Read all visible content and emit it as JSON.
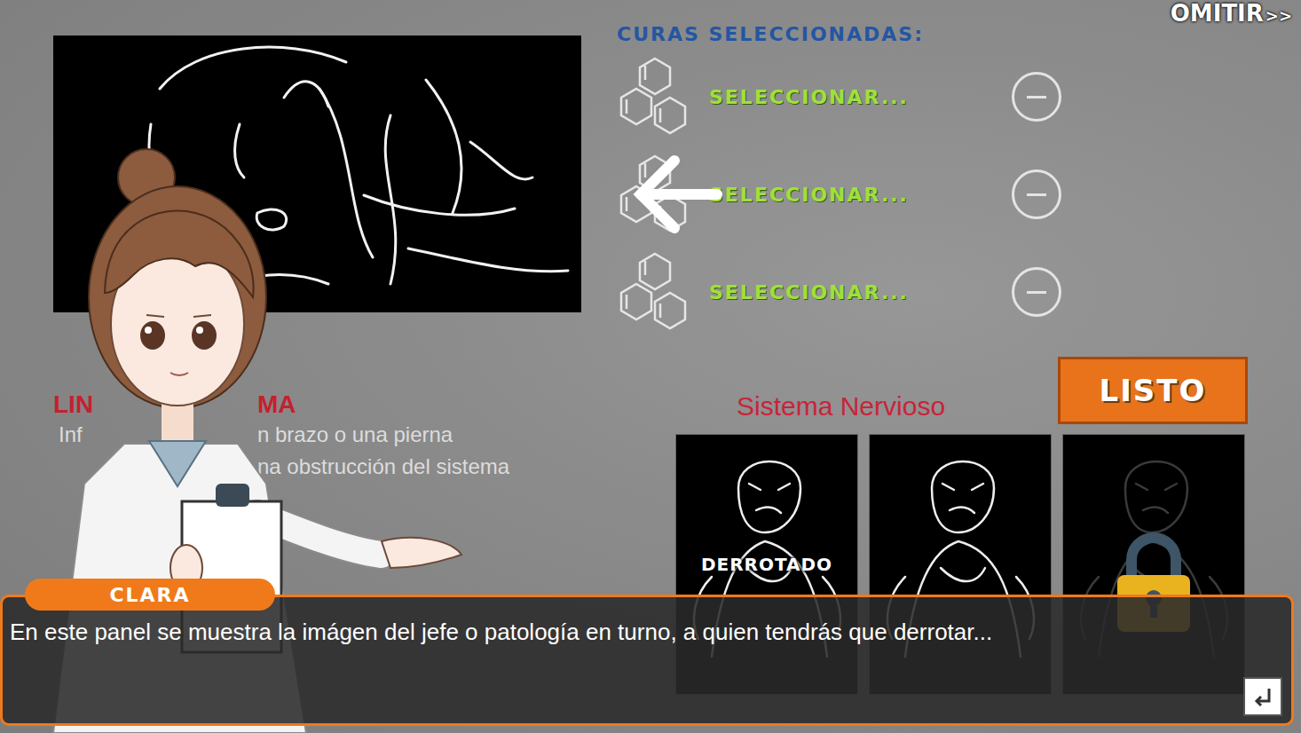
{
  "skip": {
    "label": "OMITIR",
    "icon": ">>"
  },
  "boss_info": {
    "title_visible": [
      "LIN",
      "MA"
    ],
    "description_visible": [
      [
        "Inf",
        "n brazo o una pierna"
      ],
      [
        "",
        "na obstrucción del sistema"
      ]
    ]
  },
  "cures": {
    "title": "CURAS SELECCIONADAS:",
    "slots": [
      {
        "label": "SELECCIONAR...",
        "pointed": false
      },
      {
        "label": "SELECCIONAR...",
        "pointed": true
      },
      {
        "label": "SELECCIONAR...",
        "pointed": false
      }
    ]
  },
  "ready_button": "LISTO",
  "system": {
    "title": "Sistema Nervioso",
    "bosses": [
      {
        "label": "DERROTADO",
        "defeated": true,
        "locked": false
      },
      {
        "defeated": false,
        "locked": false
      },
      {
        "defeated": false,
        "locked": true
      }
    ]
  },
  "dialog": {
    "speaker": "CLARA",
    "text": "En este panel se muestra la imágen del jefe o patología en turno, a quien tendrás que derrotar..."
  }
}
